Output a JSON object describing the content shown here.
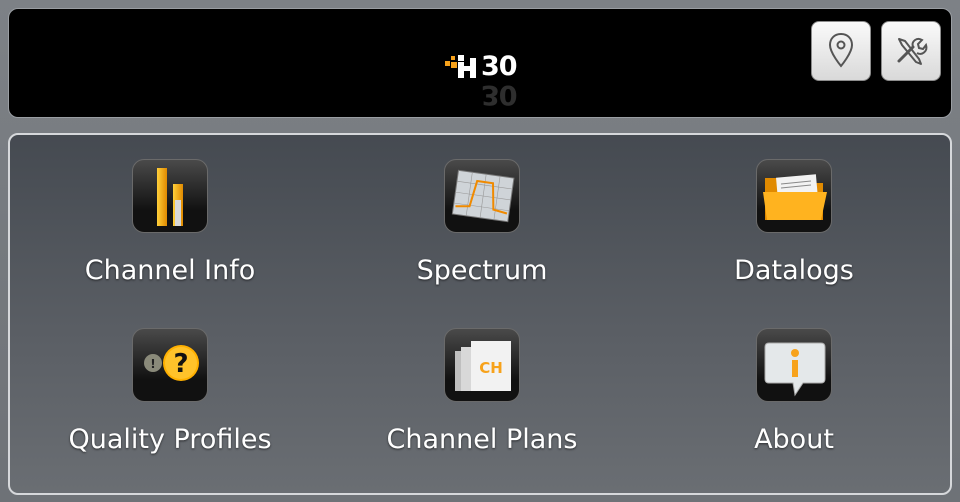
{
  "header": {
    "logo_text": "30",
    "location_button": "location-pin-icon",
    "settings_button": "tools-icon"
  },
  "menu": {
    "items": [
      {
        "label": "Channel Info",
        "icon": "bar-chart-icon"
      },
      {
        "label": "Spectrum",
        "icon": "spectrum-graph-icon"
      },
      {
        "label": "Datalogs",
        "icon": "folder-icon"
      },
      {
        "label": "Quality Profiles",
        "icon": "question-icon"
      },
      {
        "label": "Channel Plans",
        "icon": "channel-plans-icon"
      },
      {
        "label": "About",
        "icon": "info-icon"
      }
    ],
    "channel_plans_badge": "CH"
  },
  "colors": {
    "accent": "#f7a21b",
    "header_bg": "#000000"
  }
}
